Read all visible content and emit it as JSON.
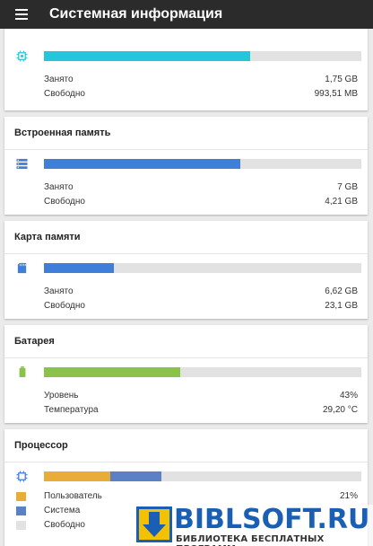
{
  "appbar": {
    "title": "Системная информация",
    "menu_icon": "hamburger-menu-icon"
  },
  "colors": {
    "ram": "#26c6da",
    "internal": "#3f7fd9",
    "sdcard": "#3f7fd9",
    "battery": "#8bc34a",
    "cpu_user": "#e8ad38",
    "cpu_system": "#5b80c4",
    "cpu_free": "#e2e2e2"
  },
  "ram": {
    "icon": "chip-icon",
    "fill_fraction": 0.65,
    "used_label": "Занято",
    "used_value": "1,75 GB",
    "free_label": "Свободно",
    "free_value": "993,51 MB"
  },
  "internal": {
    "title": "Встроенная память",
    "icon": "storage-icon",
    "fill_fraction": 0.62,
    "used_label": "Занято",
    "used_value": "7 GB",
    "free_label": "Свободно",
    "free_value": "4,21 GB"
  },
  "sdcard": {
    "title": "Карта памяти",
    "icon": "sd-card-icon",
    "fill_fraction": 0.22,
    "used_label": "Занято",
    "used_value": "6,62 GB",
    "free_label": "Свободно",
    "free_value": "23,1 GB"
  },
  "battery": {
    "title": "Батарея",
    "icon": "battery-icon",
    "fill_fraction": 0.43,
    "level_label": "Уровень",
    "level_value": "43%",
    "temp_label": "Температура",
    "temp_value": "29,20 °C"
  },
  "cpu": {
    "title": "Процессор",
    "icon": "cpu-icon",
    "user_fraction": 0.21,
    "system_fraction": 0.16,
    "legend": [
      {
        "label": "Пользователь",
        "value": "21%"
      },
      {
        "label": "Система",
        "value": ""
      },
      {
        "label": "Свободно",
        "value": ""
      }
    ]
  },
  "watermark": {
    "title": "BIBLSOFT.RU",
    "subtitle": "БИБЛИОТЕКА БЕСПЛАТНЫХ ПРОГРАММ"
  }
}
